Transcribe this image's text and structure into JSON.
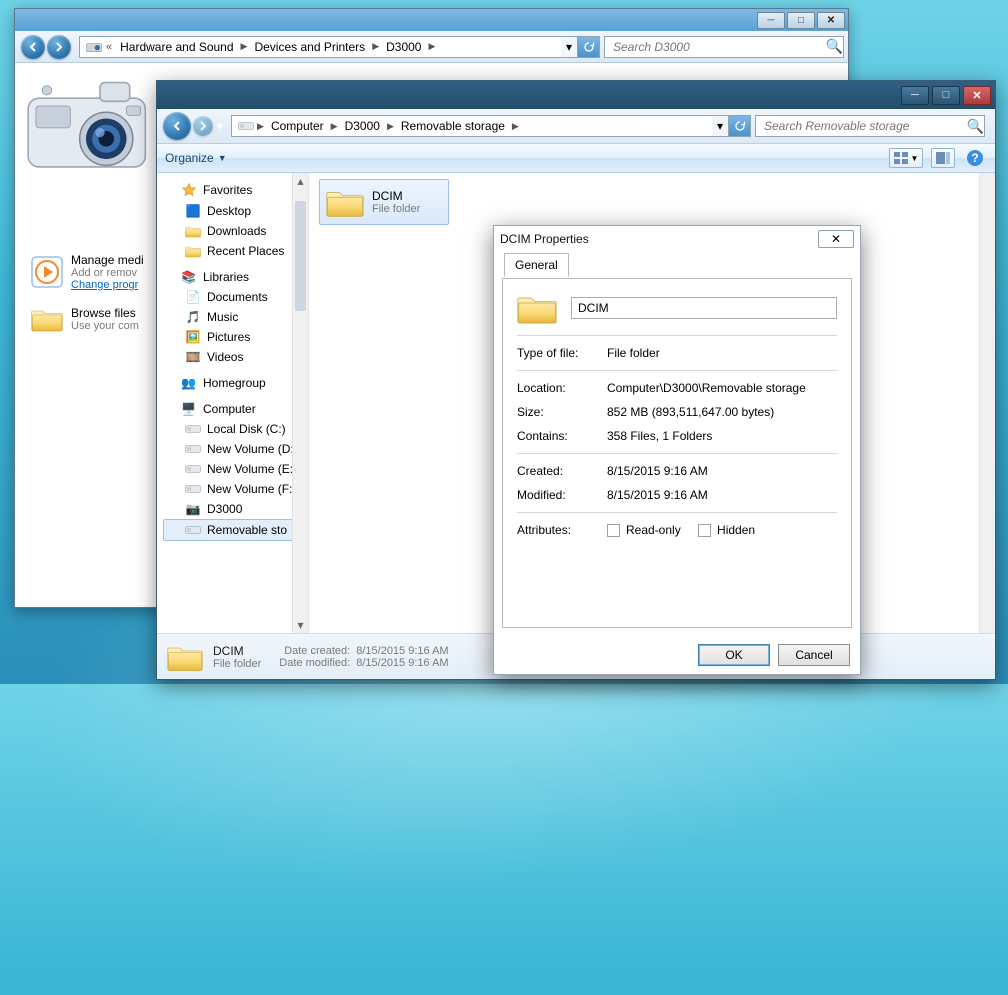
{
  "win1": {
    "breadcrumbs": [
      "Hardware and Sound",
      "Devices and Printers",
      "D3000"
    ],
    "search_placeholder": "Search D3000",
    "actions": [
      {
        "title": "Manage medi",
        "subtitle": "Add or remov",
        "link": "Change progr"
      },
      {
        "title": "Browse files",
        "subtitle": "Use your com"
      }
    ]
  },
  "win2": {
    "breadcrumbs": [
      "Computer",
      "D3000",
      "Removable storage"
    ],
    "search_placeholder": "Search Removable storage",
    "toolbar": {
      "organize": "Organize"
    },
    "nav": {
      "favorites": {
        "label": "Favorites",
        "items": [
          "Desktop",
          "Downloads",
          "Recent Places"
        ]
      },
      "libraries": {
        "label": "Libraries",
        "items": [
          "Documents",
          "Music",
          "Pictures",
          "Videos"
        ]
      },
      "homegroup": {
        "label": "Homegroup"
      },
      "computer": {
        "label": "Computer",
        "items": [
          "Local Disk (C:)",
          "New Volume (D:)",
          "New Volume (E:)",
          "New Volume (F:)",
          "D3000",
          "Removable sto"
        ]
      }
    },
    "tile": {
      "name": "DCIM",
      "kind": "File folder"
    },
    "details": {
      "name": "DCIM",
      "kind": "File folder",
      "date_created_label": "Date created:",
      "date_created": "8/15/2015 9:16 AM",
      "date_modified_label": "Date modified:",
      "date_modified": "8/15/2015 9:16 AM"
    }
  },
  "props": {
    "title": "DCIM Properties",
    "tab_general": "General",
    "name_value": "DCIM",
    "fields": {
      "type_of_file_label": "Type of file:",
      "type_of_file": "File folder",
      "location_label": "Location:",
      "location": "Computer\\D3000\\Removable storage",
      "size_label": "Size:",
      "size": "852 MB (893,511,647.00 bytes)",
      "contains_label": "Contains:",
      "contains": "358 Files, 1 Folders",
      "created_label": "Created:",
      "created": "8/15/2015 9:16 AM",
      "modified_label": "Modified:",
      "modified": "8/15/2015 9:16 AM",
      "attributes_label": "Attributes:",
      "readonly_label": "Read-only",
      "hidden_label": "Hidden"
    },
    "ok": "OK",
    "cancel": "Cancel"
  }
}
